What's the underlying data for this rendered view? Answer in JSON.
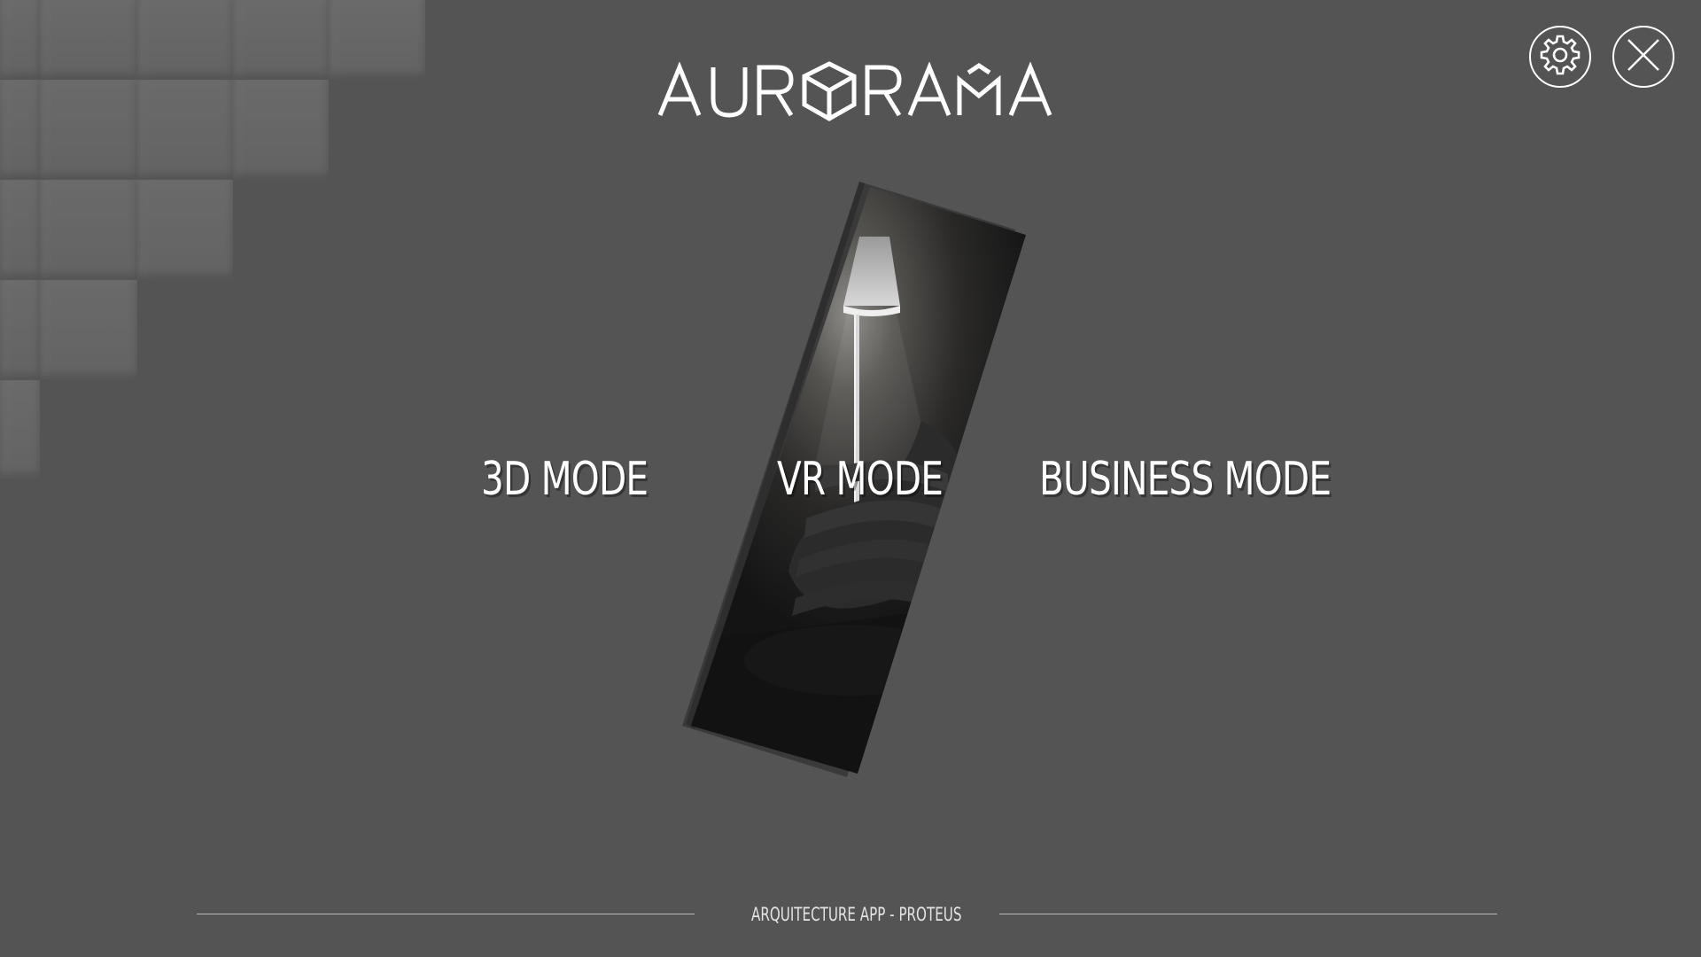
{
  "app": {
    "logo_text": "AURORAMA"
  },
  "toolbar": {
    "settings_icon": "gear-icon",
    "close_icon": "close-icon"
  },
  "modes": {
    "mode_3d": "3D MODE",
    "mode_vr": "VR MODE",
    "mode_business": "BUSINESS MODE"
  },
  "footer": {
    "text": "ARQUITECTURE APP - PROTEUS"
  },
  "colors": {
    "background": "#545454",
    "text": "#ffffff",
    "footer_line": "#b8b8b8"
  }
}
